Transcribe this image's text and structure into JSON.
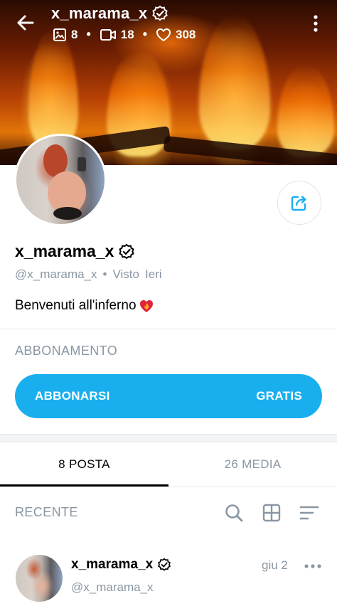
{
  "header": {
    "title": "x_marama_x",
    "stats": {
      "photos": "8",
      "videos": "18",
      "likes": "308"
    }
  },
  "profile": {
    "name": "x_marama_x",
    "handle": "@x_marama_x",
    "separator": "•",
    "last_seen": "Visto",
    "last_seen_value": "Ieri",
    "bio": "Benvenuti all'inferno"
  },
  "subscription": {
    "section_title": "ABBONAMENTO",
    "button_label": "ABBONARSI",
    "button_price": "GRATIS"
  },
  "tabs": [
    {
      "label": "8 POSTA",
      "active": true
    },
    {
      "label": "26 MEDIA",
      "active": false
    }
  ],
  "feed": {
    "section_title": "RECENTE",
    "tools": [
      "search-icon",
      "grid-icon",
      "sort-icon"
    ],
    "posts": [
      {
        "author_name": "x_marama_x",
        "author_handle": "@x_marama_x",
        "date": "giu 2"
      }
    ]
  },
  "colors": {
    "accent": "#19afee",
    "muted_text": "#8a96a3",
    "divider": "#e6e9ec"
  }
}
